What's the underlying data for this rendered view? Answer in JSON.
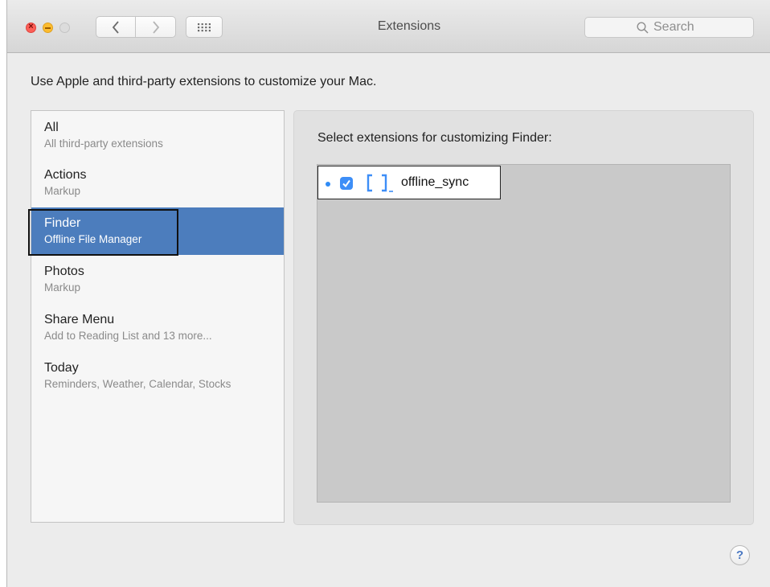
{
  "window": {
    "title": "Extensions"
  },
  "toolbar": {
    "back_icon": "chevron-left-icon",
    "forward_icon": "chevron-right-icon",
    "grid_icon": "grid-icon",
    "search_placeholder": "Search",
    "search_icon": "search-icon"
  },
  "instructions": "Use Apple and third-party extensions to customize your Mac.",
  "sidebar": {
    "items": [
      {
        "name": "All",
        "sub": "All third-party extensions",
        "selected": false
      },
      {
        "name": "Actions",
        "sub": "Markup",
        "selected": false
      },
      {
        "name": "Finder",
        "sub": "Offline File Manager",
        "selected": true
      },
      {
        "name": "Photos",
        "sub": "Markup",
        "selected": false
      },
      {
        "name": "Share Menu",
        "sub": "Add to Reading List and 13 more...",
        "selected": false
      },
      {
        "name": "Today",
        "sub": "Reminders, Weather, Calendar, Stocks",
        "selected": false
      }
    ]
  },
  "panel": {
    "heading": "Select extensions for customizing Finder:",
    "extensions": [
      {
        "name": "offline_sync",
        "enabled": true,
        "icon": "bracket-app-icon"
      }
    ]
  },
  "help": {
    "label": "?"
  },
  "colors": {
    "selection": "#4c7dbd",
    "checkbox": "#3d8ef7",
    "close": "#fc5f57",
    "minimize": "#fdbc2e"
  }
}
